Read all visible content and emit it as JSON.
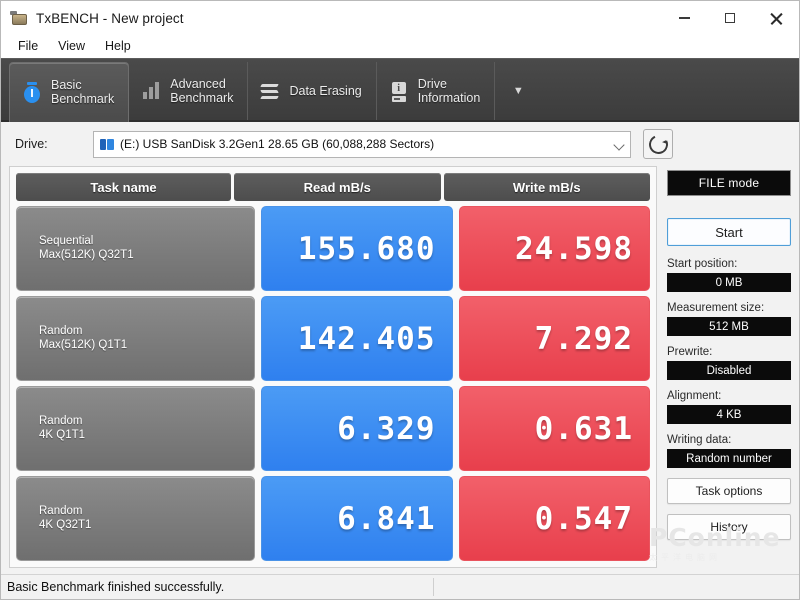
{
  "window": {
    "title": "TxBENCH - New project",
    "app_icon": "usb-drive-icon",
    "controls": {
      "minimize": "minimize-icon",
      "maximize": "maximize-icon",
      "close": "close-icon"
    }
  },
  "menu": {
    "items": [
      "File",
      "View",
      "Help"
    ]
  },
  "tabs": {
    "items": [
      {
        "label": "Basic\nBenchmark",
        "icon": "stopwatch-icon",
        "active": true
      },
      {
        "label": "Advanced\nBenchmark",
        "icon": "bar-chart-icon",
        "active": false
      },
      {
        "label": "Data Erasing",
        "icon": "scribble-erase-icon",
        "active": false
      },
      {
        "label": "Drive\nInformation",
        "icon": "drive-info-icon",
        "active": false
      }
    ],
    "overflow": "▼"
  },
  "drive": {
    "label": "Drive:",
    "selected": "(E:) USB SanDisk 3.2Gen1  28.65 GB (60,088,288 Sectors)",
    "icon": "usb-drive-icon",
    "refresh": "refresh-icon"
  },
  "results": {
    "headers": [
      "Task name",
      "Read mB/s",
      "Write mB/s"
    ],
    "rows": [
      {
        "name_line1": "Sequential",
        "name_line2": "Max(512K) Q32T1",
        "read": "155.680",
        "write": "24.598"
      },
      {
        "name_line1": "Random",
        "name_line2": "Max(512K) Q1T1",
        "read": "142.405",
        "write": "7.292"
      },
      {
        "name_line1": "Random",
        "name_line2": "4K Q1T1",
        "read": "6.329",
        "write": "0.631"
      },
      {
        "name_line1": "Random",
        "name_line2": "4K Q32T1",
        "read": "6.841",
        "write": "0.547"
      }
    ]
  },
  "sidebar": {
    "file_mode": "FILE mode",
    "start": "Start",
    "fields": [
      {
        "label": "Start position:",
        "value": "0 MB"
      },
      {
        "label": "Measurement size:",
        "value": "512 MB"
      },
      {
        "label": "Prewrite:",
        "value": "Disabled"
      },
      {
        "label": "Alignment:",
        "value": "4 KB"
      },
      {
        "label": "Writing data:",
        "value": "Random number"
      }
    ],
    "task_options": "Task options",
    "history": "History"
  },
  "watermark": {
    "text": "PConline",
    "sub": "太平洋电脑网"
  },
  "status": {
    "message": "Basic Benchmark finished successfully."
  },
  "colors": {
    "read_accent": "#2f80ef",
    "write_accent": "#e83f4c",
    "tab_bar": "#444444",
    "field_value_bg": "#0b0b0b",
    "start_border": "#4f9ed8"
  }
}
